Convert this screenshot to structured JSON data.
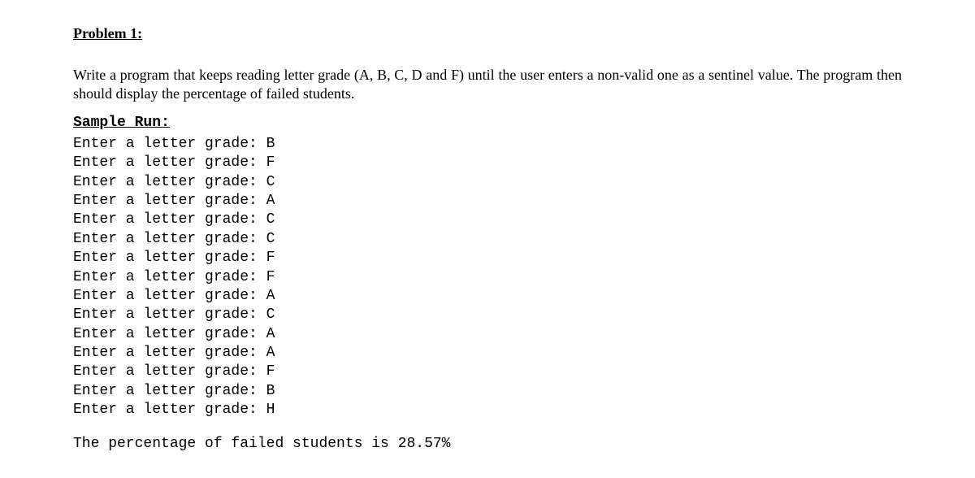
{
  "problem": {
    "title": "Problem 1:",
    "description": "Write a program that keeps reading letter grade (A, B, C, D and F) until the user enters a non-valid one as a sentinel value. The program then should display the percentage of failed students."
  },
  "sample_run": {
    "label": "Sample Run:",
    "prompt": "Enter a letter grade: ",
    "grades": [
      "B",
      "F",
      "C",
      "A",
      "C",
      "C",
      "F",
      "F",
      "A",
      "C",
      "A",
      "A",
      "F",
      "B",
      "H"
    ],
    "result": "The percentage of failed students is 28.57%"
  }
}
